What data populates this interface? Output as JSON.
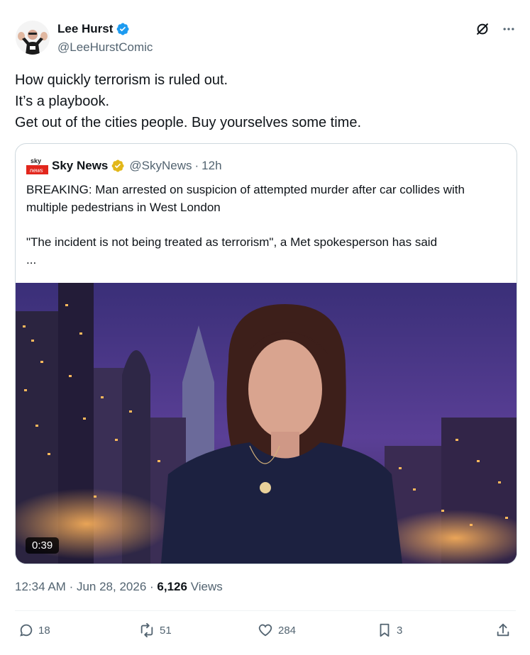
{
  "author": {
    "name": "Lee Hurst",
    "handle": "@LeeHurstComic",
    "verified_color": "#1d9bf0"
  },
  "tweet": {
    "lines": [
      "How quickly terrorism is ruled out.",
      "It’s a playbook.",
      "Get out of the cities people. Buy yourselves some time."
    ]
  },
  "quote": {
    "name": "Sky News",
    "handle": "@SkyNews",
    "separator": "·",
    "time": "12h",
    "verified_color": "#e2b719",
    "logo_text_top": "sky",
    "logo_text_bottom": "news",
    "body": [
      "BREAKING: Man arrested on suspicion of attempted murder after car collides with multiple pedestrians in West London",
      "\"The incident is not being treated as terrorism\", a Met spokesperson has said",
      "..."
    ],
    "video_duration": "0:39"
  },
  "meta": {
    "time": "12:34 AM",
    "sep1": "·",
    "date": "Jun 28, 2026",
    "sep2": "·",
    "views_count": "6,126",
    "views_label": "Views"
  },
  "actions": {
    "replies": "18",
    "reposts": "51",
    "likes": "284",
    "bookmarks": "3"
  },
  "icons": [
    "grok-icon",
    "more-icon",
    "reply-icon",
    "repost-icon",
    "like-icon",
    "bookmark-icon",
    "share-icon"
  ]
}
